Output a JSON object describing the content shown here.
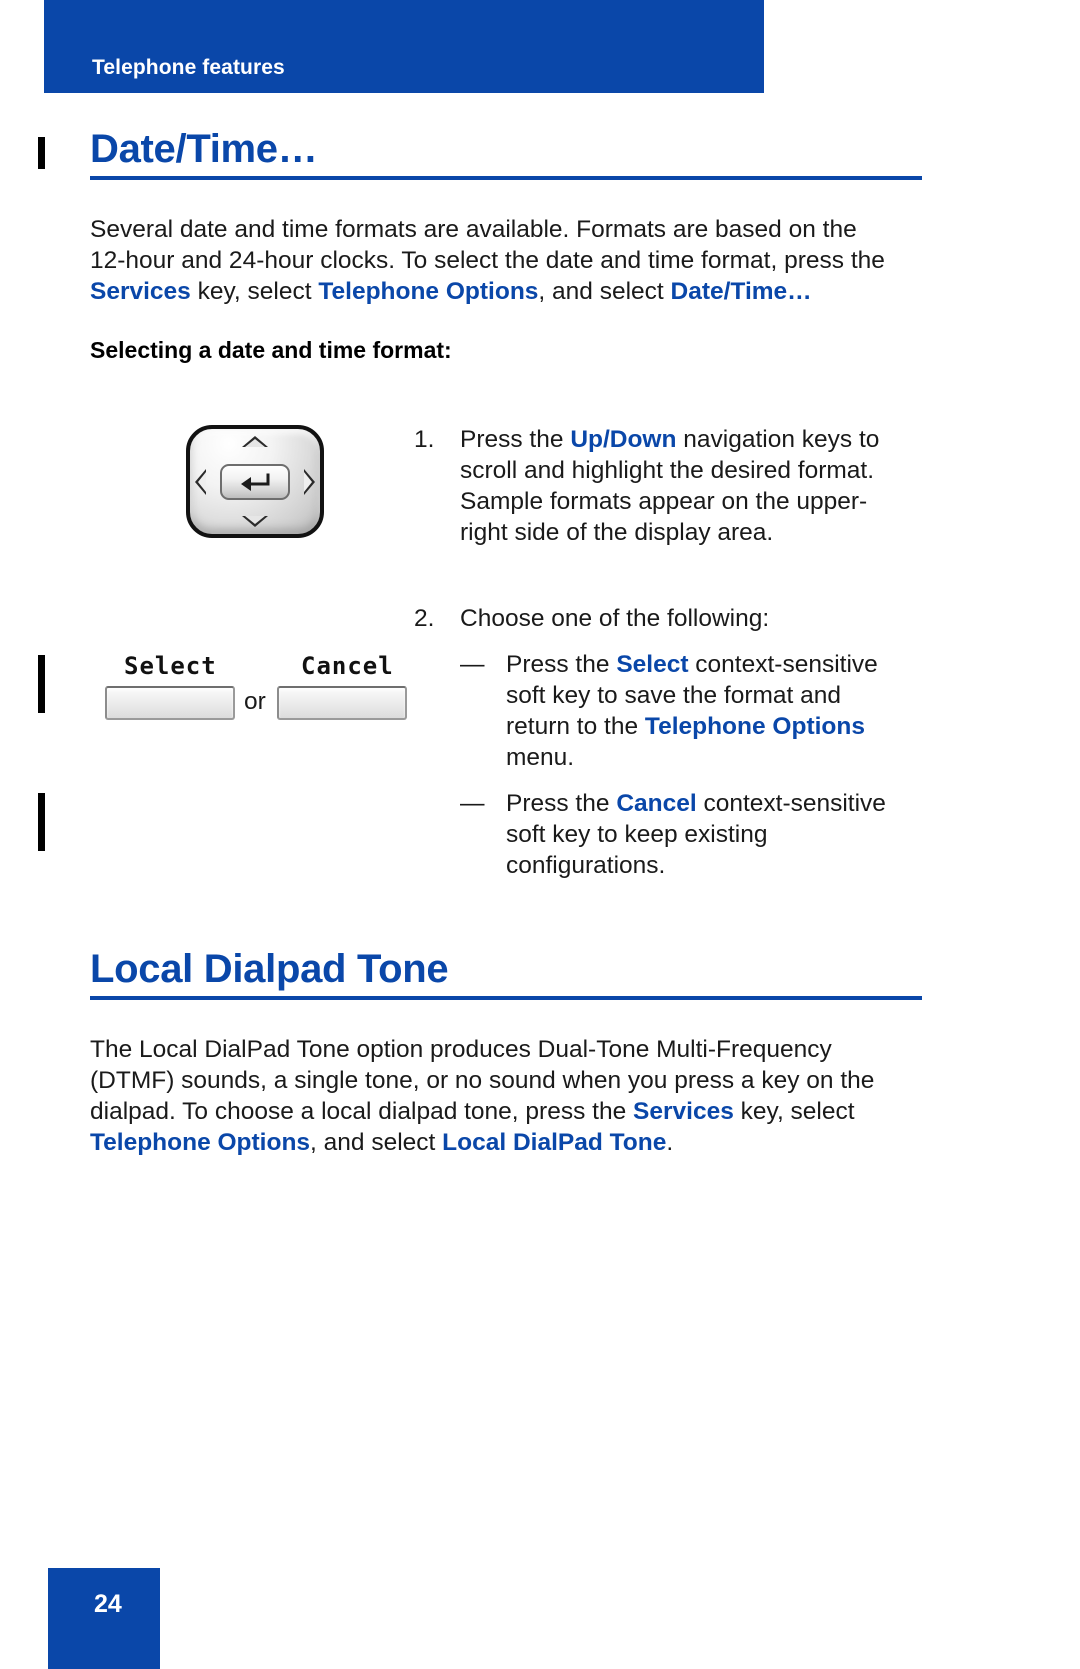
{
  "page": {
    "running_header": "Telephone features",
    "page_number": "24",
    "accent_color": "#0A47A9",
    "text_color": "#1a1a1a"
  },
  "section_date_time": {
    "heading": "Date/Time…",
    "intro_line1": "Several date and time formats are available. Formats are based on the",
    "intro_line2": "12-hour and 24-hour clocks. To select the date and time format, press the",
    "intro_line3_kw1": "Services",
    "intro_line3_mid1": " key, select ",
    "intro_line3_kw2": "Telephone Options",
    "intro_line3_mid2": ", and select ",
    "intro_line3_kw3": "Date/Time…",
    "subheading": "Selecting a date and time format:",
    "step1": {
      "number": "1.",
      "line1_pre": "Press the ",
      "line1_kw": "Up/Down",
      "line1_post": " navigation keys to",
      "line2": "scroll and highlight the desired format.",
      "line3": "Sample formats appear on the upper-",
      "line4": "right side of the display area."
    },
    "step2": {
      "number": "2.",
      "lead": "Choose one of the following:",
      "bullets": [
        {
          "dash": "—",
          "line1_pre": "Press the ",
          "line1_kw": "Select",
          "line1_post": " context-sensitive",
          "line2": "soft key to save the format and",
          "line3_pre": "return to the ",
          "line3_kw": "Telephone Options",
          "line4": "menu."
        },
        {
          "dash": "—",
          "line1_pre": "Press the ",
          "line1_kw": "Cancel",
          "line1_post": " context-sensitive",
          "line2": "soft key to keep existing",
          "line3": "configurations."
        }
      ]
    },
    "graphics": {
      "nav_key_name": "navigation-keys",
      "softkey_select_label": "Select",
      "softkey_cancel_label": "Cancel",
      "or_label": "or"
    }
  },
  "section_local_dialpad_tone": {
    "heading": "Local Dialpad Tone",
    "body_line1": "The Local DialPad Tone option produces Dual-Tone Multi-Frequency",
    "body_line2": "(DTMF) sounds, a single tone, or no sound when you press a key on the",
    "body_line3_pre": "dialpad. To choose a local dialpad tone, press the ",
    "body_line3_kw": "Services",
    "body_line3_post": " key, select",
    "body_line4_kw1": "Telephone Options",
    "body_line4_mid": ", and select ",
    "body_line4_kw2": "Local DialPad Tone",
    "body_line4_end": "."
  }
}
